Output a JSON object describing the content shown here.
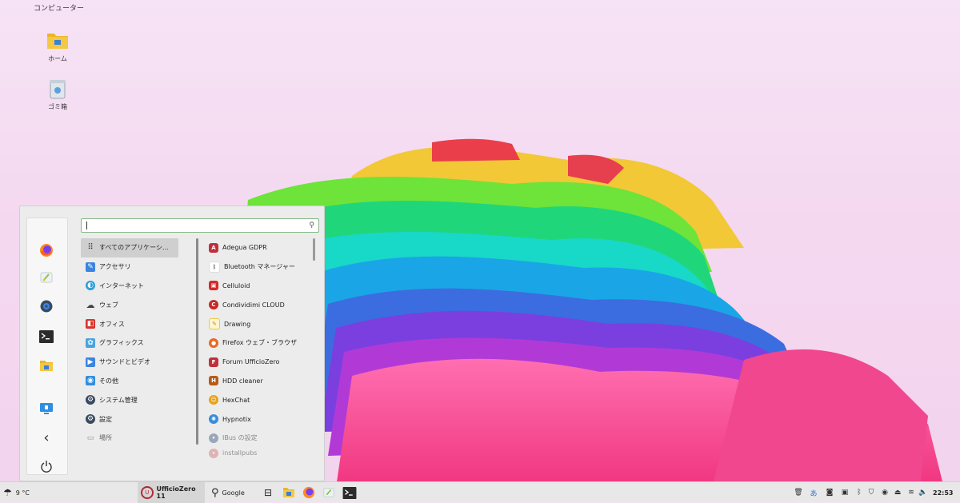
{
  "desktop": {
    "top_label": "コンピューター",
    "icons": [
      {
        "label": "ホーム",
        "icon": "folder-icon"
      },
      {
        "label": "ゴミ箱",
        "icon": "trash-icon"
      }
    ]
  },
  "menu": {
    "search": {
      "value": "",
      "placeholder": ""
    },
    "favorites": [
      "firefox-icon",
      "paint-icon",
      "settings-icon",
      "terminal-icon",
      "files-icon",
      "remote-desktop-icon",
      "back-icon",
      "power-icon"
    ],
    "categories": [
      {
        "label": "すべてのアプリケーシ...",
        "active": true
      },
      {
        "label": "アクセサリ"
      },
      {
        "label": "インターネット"
      },
      {
        "label": "ウェブ"
      },
      {
        "label": "オフィス"
      },
      {
        "label": "グラフィックス"
      },
      {
        "label": "サウンドとビデオ"
      },
      {
        "label": "その他"
      },
      {
        "label": "システム管理"
      },
      {
        "label": "設定"
      },
      {
        "label": "場所"
      }
    ],
    "apps": [
      {
        "label": "Adegua GDPR",
        "color": "#c0303a"
      },
      {
        "label": "Bluetooth マネージャー",
        "color": "#ffffff"
      },
      {
        "label": "Celluloid",
        "color": "#d42a2a"
      },
      {
        "label": "Condividimi CLOUD",
        "color": "#c62828"
      },
      {
        "label": "Drawing",
        "color": "#f2c12e"
      },
      {
        "label": "Firefox ウェブ・ブラウザ",
        "color": "#e86a1f"
      },
      {
        "label": "Forum UfficioZero",
        "color": "#c0303a"
      },
      {
        "label": "HDD cleaner",
        "color": "#b85a1a"
      },
      {
        "label": "HexChat",
        "color": "#e8a21a"
      },
      {
        "label": "Hypnotix",
        "color": "#3a8ed8"
      },
      {
        "label": "IBus の設定",
        "color": "#9aa7b8"
      },
      {
        "label": "installpubs",
        "color": "#d07070"
      }
    ]
  },
  "taskbar": {
    "weather": "9 °C",
    "start_label": "UfficioZero 11",
    "search_label": "Google",
    "clock": "22:53"
  }
}
